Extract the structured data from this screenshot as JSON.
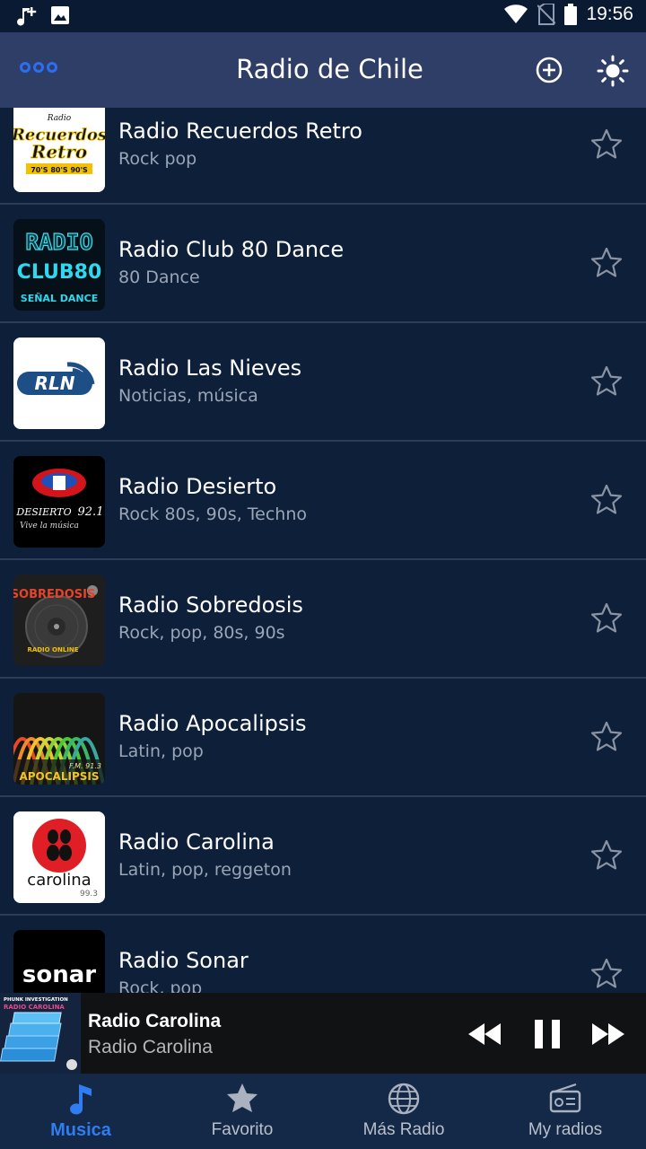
{
  "status_bar": {
    "time": "19:56",
    "icons": [
      "music-note-add-icon",
      "image-icon",
      "wifi-icon",
      "no-sim-icon",
      "battery-icon"
    ]
  },
  "app_bar": {
    "title": "Radio de Chile",
    "actions": [
      "menu-dots-icon",
      "add-circle-icon",
      "brightness-icon"
    ],
    "accent": "#2b6ef2"
  },
  "stations": [
    {
      "name": "Radio Recuerdos Retro",
      "genre": "Rock pop",
      "logo_text": [
        "Radio",
        "Recuerdos",
        "Retro",
        "70'S 80'S 90'S"
      ]
    },
    {
      "name": "Radio Club 80 Dance",
      "genre": " 80 Dance",
      "logo_text": [
        "RADIO",
        "CLUB80",
        "SEÑAL DANCE"
      ]
    },
    {
      "name": "Radio Las Nieves",
      "genre": "Noticias, música",
      "logo_text": [
        "RLN"
      ]
    },
    {
      "name": "Radio Desierto",
      "genre": "Rock 80s, 90s, Techno",
      "logo_text": [
        "DESIERTO",
        "92.1",
        "Vive la música"
      ]
    },
    {
      "name": "Radio Sobredosis",
      "genre": "Rock, pop, 80s, 90s",
      "logo_text": [
        "SOBREDOSIS",
        "RADIO ONLINE"
      ]
    },
    {
      "name": "Radio Apocalipsis",
      "genre": " Latin, pop",
      "logo_text": [
        "F.M. 91.3",
        "APOCALIPSIS"
      ]
    },
    {
      "name": "Radio Carolina",
      "genre": " Latin, pop, reggeton",
      "logo_text": [
        "carolina",
        "99.3"
      ]
    },
    {
      "name": "Radio Sonar",
      "genre": "Rock, pop",
      "logo_text": [
        "sonar"
      ]
    }
  ],
  "now_playing": {
    "title": "Radio Carolina",
    "subtitle": "Radio Carolina",
    "art_text": [
      "PHUNK INVESTIGATION",
      "RADIO CAROLINA"
    ],
    "controls": [
      "rewind-icon",
      "pause-icon",
      "fast-forward-icon"
    ]
  },
  "bottom_nav": {
    "items": [
      {
        "label": "Musica",
        "icon": "music-note-icon",
        "active": true
      },
      {
        "label": "Favorito",
        "icon": "star-icon",
        "active": false
      },
      {
        "label": "Más Radio",
        "icon": "globe-icon",
        "active": false
      },
      {
        "label": "My radios",
        "icon": "radio-icon",
        "active": false
      }
    ],
    "active_color": "#2f7df0"
  }
}
